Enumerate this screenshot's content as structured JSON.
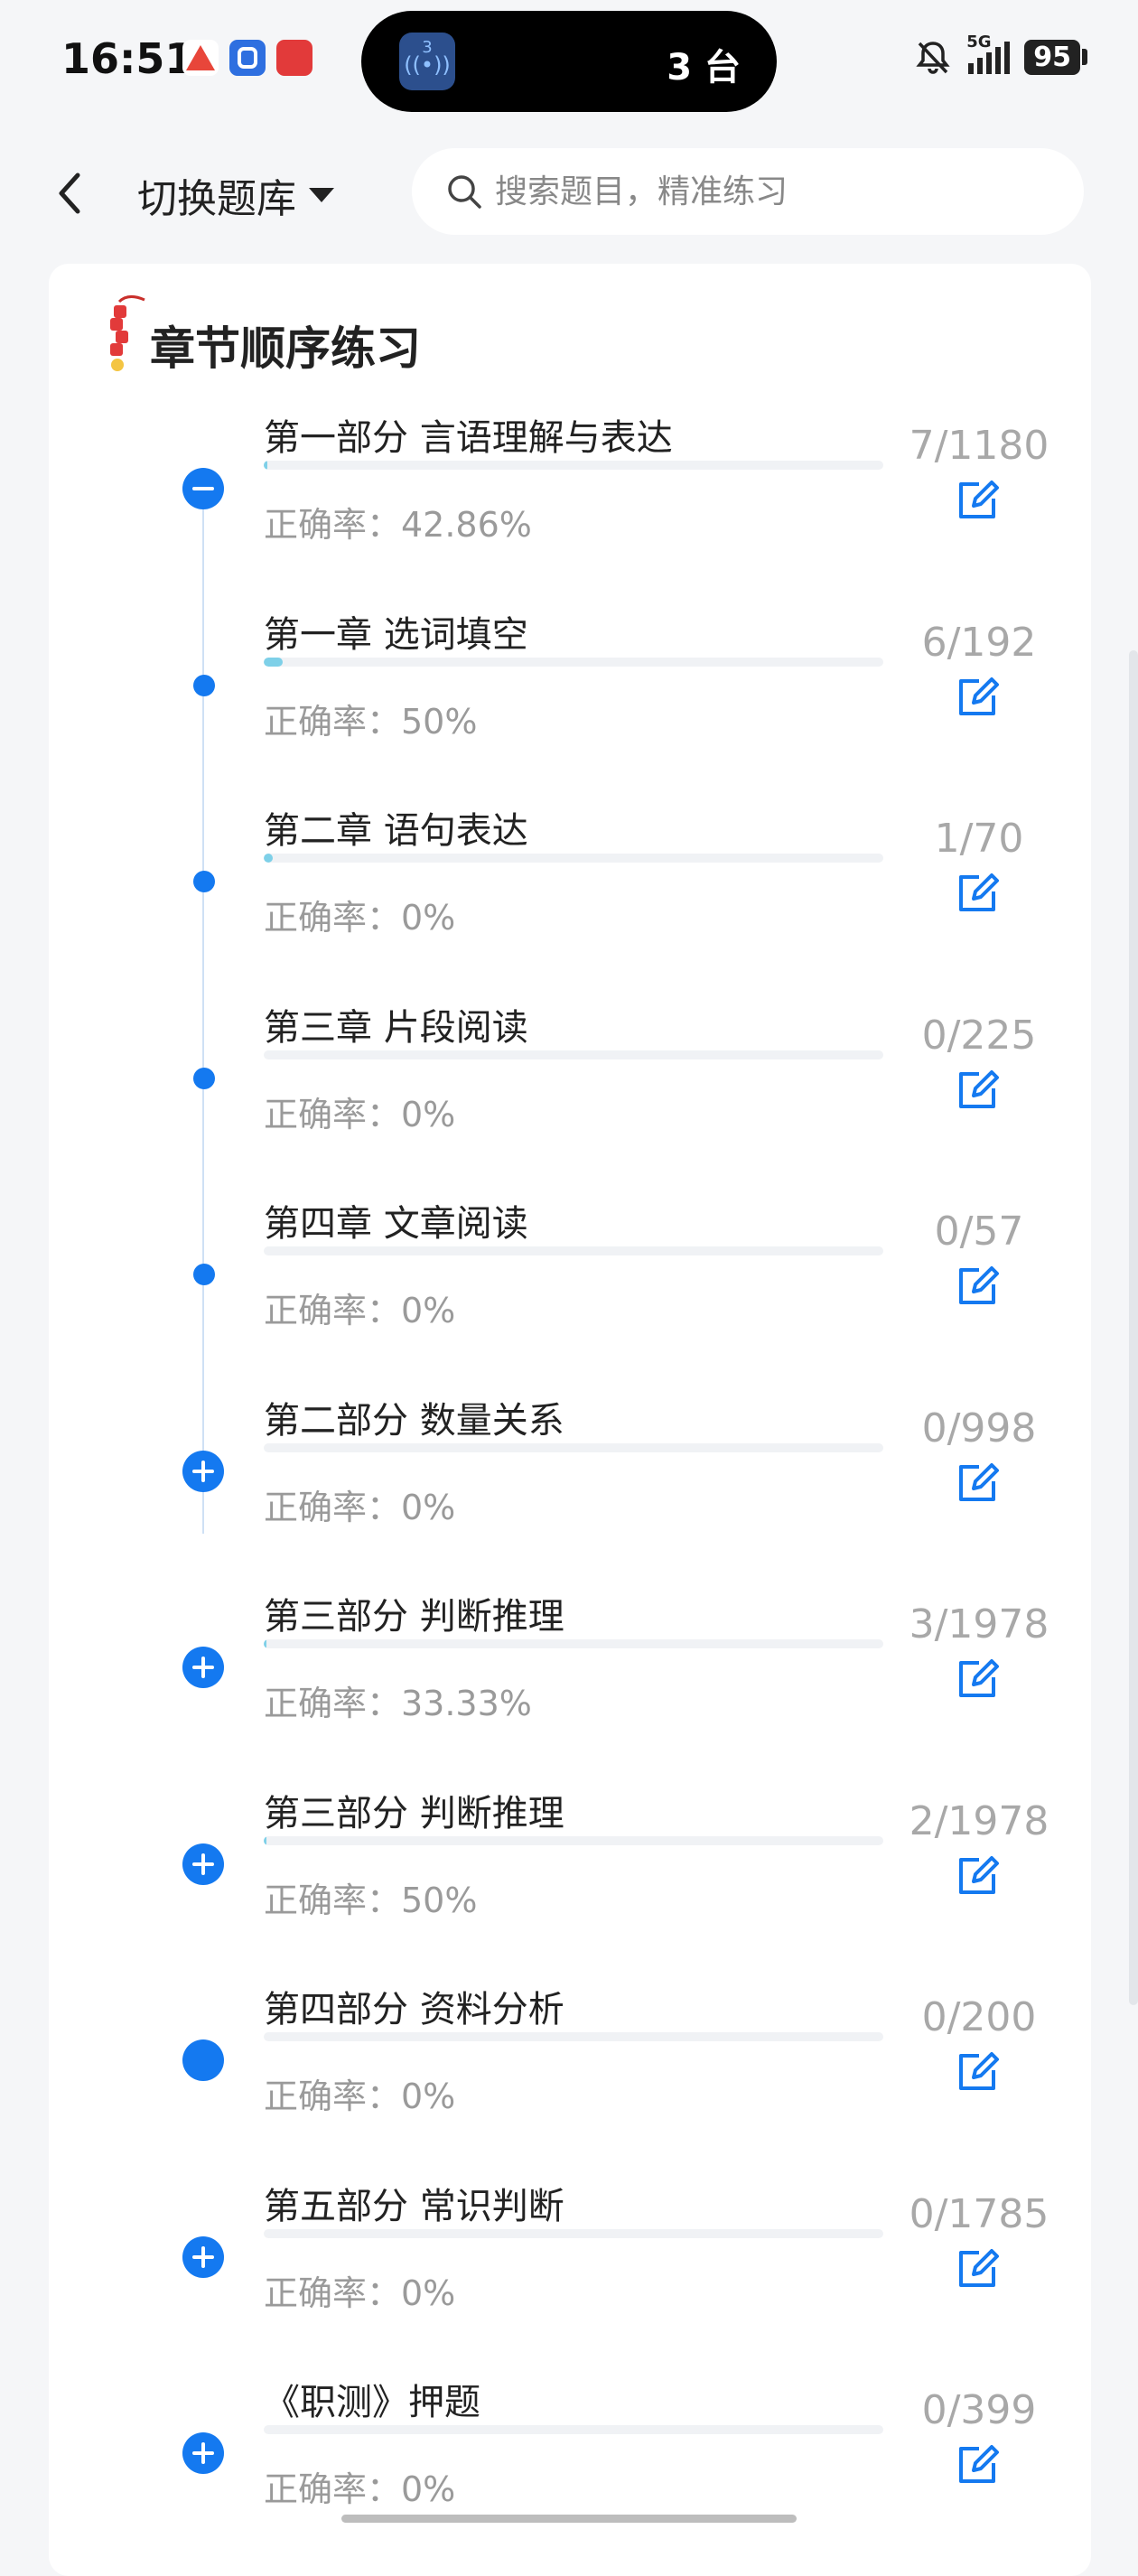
{
  "status_bar": {
    "time": "16:51",
    "island_badge": "3",
    "island_text": "3 台",
    "battery": "95",
    "network": "5G"
  },
  "header": {
    "back_icon": "chevron-left-icon",
    "switch_label": "切换题库",
    "search_placeholder": "搜索题目，精准练习"
  },
  "section": {
    "title": "章节顺序练习",
    "accent_color": "#1479f0"
  },
  "items": [
    {
      "title": "第一部分 言语理解与表达",
      "accuracy": "正确率：42.86%",
      "count": "7/1180",
      "node": "collapse-icon",
      "progress": 0.006
    },
    {
      "title": "第一章 选词填空",
      "accuracy": "正确率：50%",
      "count": "6/192",
      "node": "dot",
      "progress": 0.031
    },
    {
      "title": "第二章 语句表达",
      "accuracy": "正确率：0%",
      "count": "1/70",
      "node": "dot",
      "progress": 0.014
    },
    {
      "title": "第三章 片段阅读",
      "accuracy": "正确率：0%",
      "count": "0/225",
      "node": "dot",
      "progress": 0
    },
    {
      "title": "第四章 文章阅读",
      "accuracy": "正确率：0%",
      "count": "0/57",
      "node": "dot",
      "progress": 0
    },
    {
      "title": "第二部分 数量关系",
      "accuracy": "正确率：0%",
      "count": "0/998",
      "node": "expand-icon",
      "progress": 0
    },
    {
      "title": "第三部分 判断推理",
      "accuracy": "正确率：33.33%",
      "count": "3/1978",
      "node": "expand-icon",
      "progress": 0.0015
    },
    {
      "title": "第三部分 判断推理",
      "accuracy": "正确率：50%",
      "count": "2/1978",
      "node": "expand-icon",
      "progress": 0.001
    },
    {
      "title": "第四部分 资料分析",
      "accuracy": "正确率：0%",
      "count": "0/200",
      "node": "filled-dot",
      "progress": 0
    },
    {
      "title": "第五部分 常识判断",
      "accuracy": "正确率：0%",
      "count": "0/1785",
      "node": "expand-icon",
      "progress": 0
    },
    {
      "title": "《职测》押题",
      "accuracy": "正确率：0%",
      "count": "0/399",
      "node": "expand-icon",
      "progress": 0
    }
  ]
}
